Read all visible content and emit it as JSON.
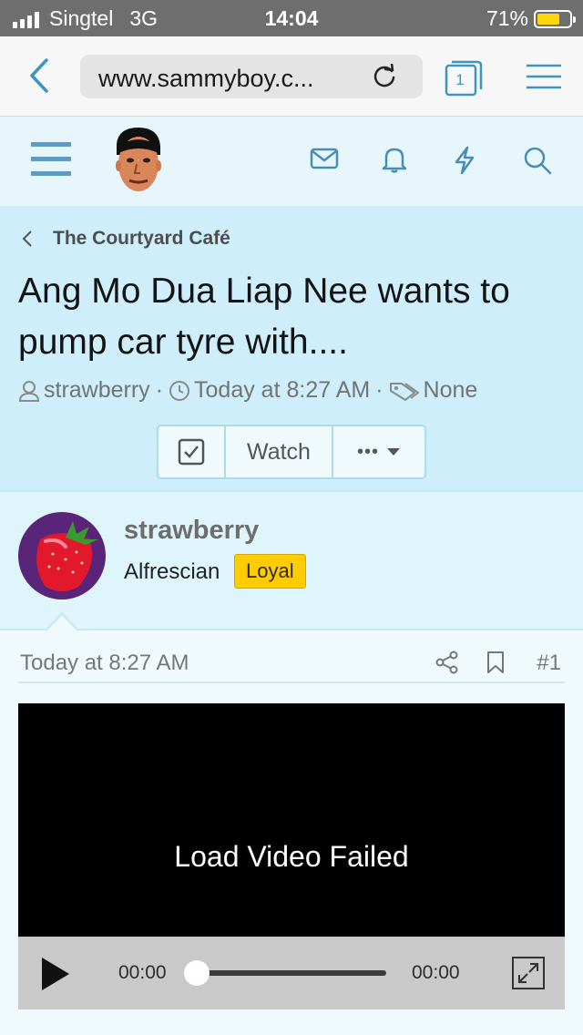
{
  "status_bar": {
    "carrier": "Singtel",
    "network": "3G",
    "time": "14:04",
    "battery": "71%",
    "battery_level": 0.71,
    "battery_color": "#ffd60a"
  },
  "browser": {
    "url": "www.sammyboy.c...",
    "tab_count": "1",
    "accent_color": "#3d95c4",
    "icons": [
      "back-icon",
      "reload-icon",
      "tabs-icon",
      "menu-icon"
    ]
  },
  "forum_header": {
    "icons": [
      "hamburger-icon",
      "site-logo",
      "mail-icon",
      "bell-icon",
      "bolt-icon",
      "search-icon"
    ]
  },
  "thread": {
    "breadcrumb": "The Courtyard Café",
    "title": "Ang Mo Dua Liap Nee wants to pump car tyre with....",
    "author": "strawberry",
    "date": "Today at 8:27 AM",
    "tags": "None",
    "separator": "·",
    "watch_label": "Watch",
    "more_label": "•••"
  },
  "user": {
    "name": "strawberry",
    "title": "Alfrescian",
    "badge": "Loyal",
    "badge_color": "#ffcc00"
  },
  "post": {
    "date": "Today at 8:27 AM",
    "number": "#1",
    "video": {
      "message": "Load Video Failed",
      "current_time": "00:00",
      "duration": "00:00",
      "progress": 0
    }
  }
}
